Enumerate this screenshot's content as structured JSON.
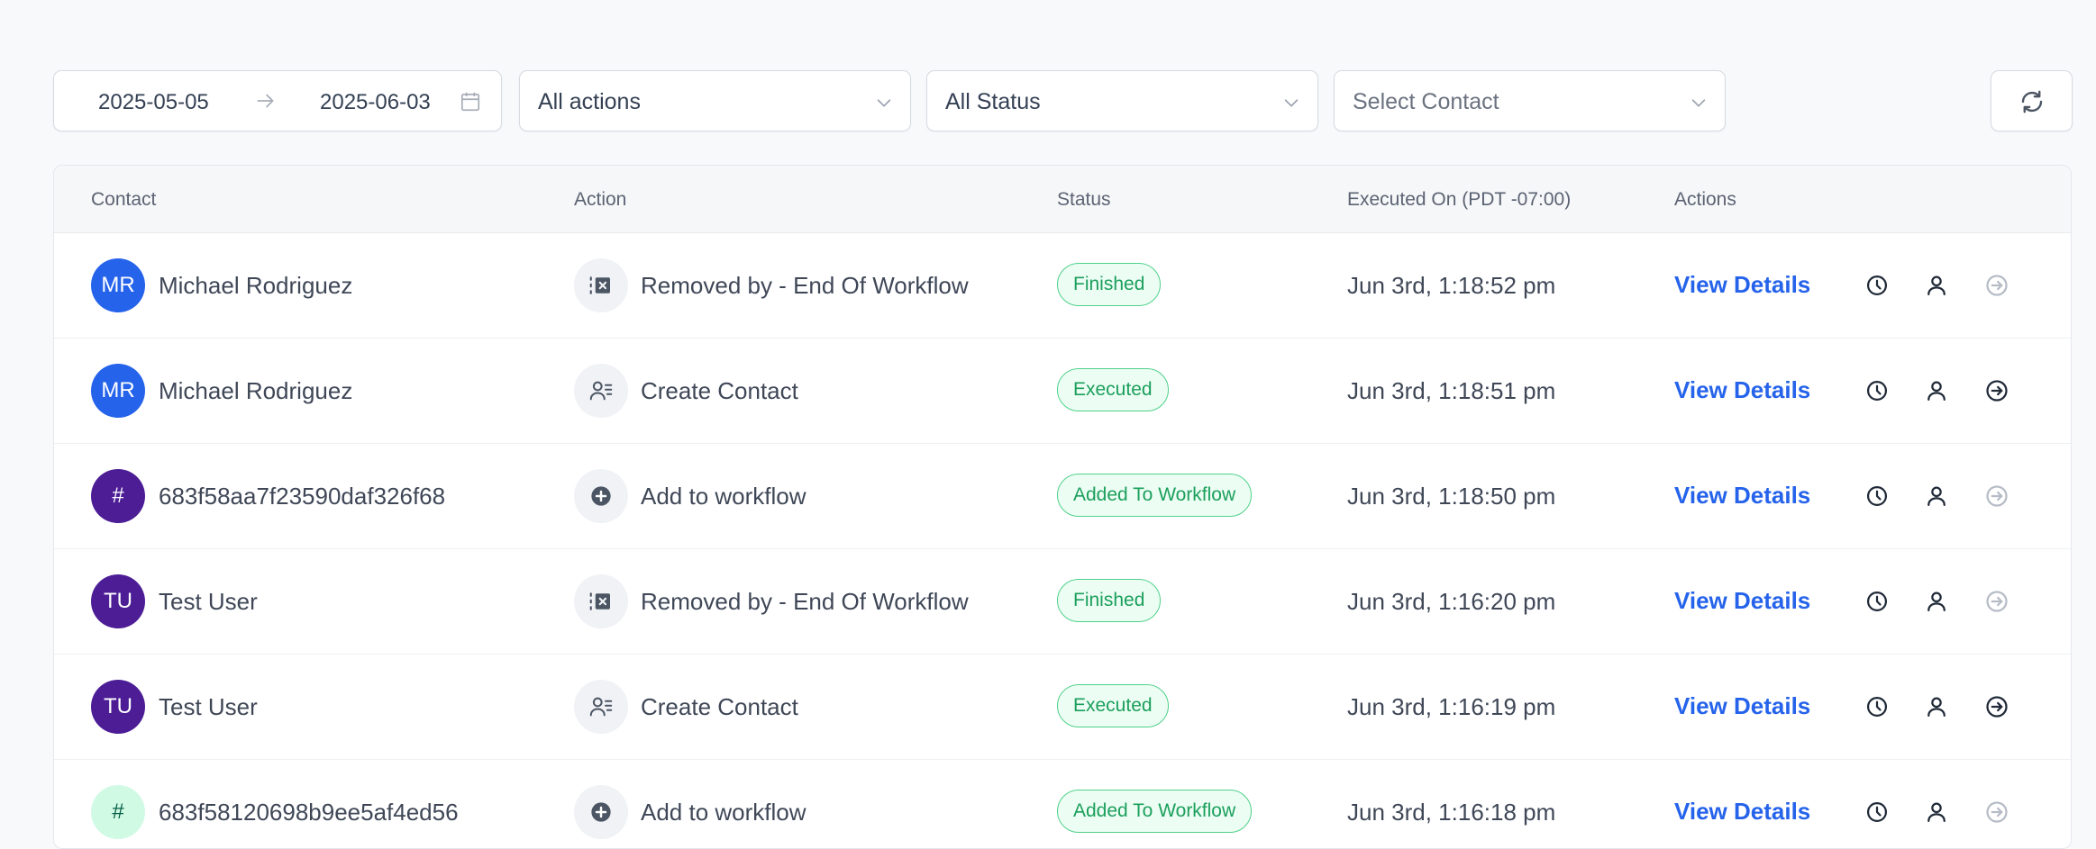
{
  "filters": {
    "date_from": "2025-05-05",
    "date_to": "2025-06-03",
    "action_select": "All actions",
    "status_select": "All Status",
    "contact_placeholder": "Select Contact"
  },
  "table": {
    "headers": {
      "contact": "Contact",
      "action": "Action",
      "status": "Status",
      "executed_on": "Executed On (PDT -07:00)",
      "actions": "Actions"
    },
    "view_details_label": "View Details",
    "rows": [
      {
        "avatar": "MR",
        "avatar_color": "#2563eb",
        "contact": "Michael Rodriguez",
        "action_icon": "remove-from-workflow-icon",
        "action": "Removed by - End Of Workflow",
        "status": "Finished",
        "executed_on": "Jun 3rd, 1:18:52 pm",
        "exit_enabled": false
      },
      {
        "avatar": "MR",
        "avatar_color": "#2563eb",
        "contact": "Michael Rodriguez",
        "action_icon": "create-contact-icon",
        "action": "Create Contact",
        "status": "Executed",
        "executed_on": "Jun 3rd, 1:18:51 pm",
        "exit_enabled": true
      },
      {
        "avatar": "#",
        "avatar_color": "#4c1d95",
        "contact": "683f58aa7f23590daf326f68",
        "action_icon": "add-circle-icon",
        "action": "Add to workflow",
        "status": "Added To Workflow",
        "executed_on": "Jun 3rd, 1:18:50 pm",
        "exit_enabled": false
      },
      {
        "avatar": "TU",
        "avatar_color": "#4c1d95",
        "contact": "Test User",
        "action_icon": "remove-from-workflow-icon",
        "action": "Removed by - End Of Workflow",
        "status": "Finished",
        "executed_on": "Jun 3rd, 1:16:20 pm",
        "exit_enabled": false
      },
      {
        "avatar": "TU",
        "avatar_color": "#4c1d95",
        "contact": "Test User",
        "action_icon": "create-contact-icon",
        "action": "Create Contact",
        "status": "Executed",
        "executed_on": "Jun 3rd, 1:16:19 pm",
        "exit_enabled": true
      },
      {
        "avatar": "#",
        "avatar_color": "#d1fae5",
        "avatar_text_color": "#065f46",
        "contact": "683f58120698b9ee5af4ed56",
        "action_icon": "add-circle-icon",
        "action": "Add to workflow",
        "status": "Added To Workflow",
        "executed_on": "Jun 3rd, 1:16:18 pm",
        "exit_enabled": false
      }
    ]
  },
  "colors": {
    "accent": "#2563eb",
    "status_green": "#1b9f5c",
    "status_bg": "#ecfdf3"
  }
}
